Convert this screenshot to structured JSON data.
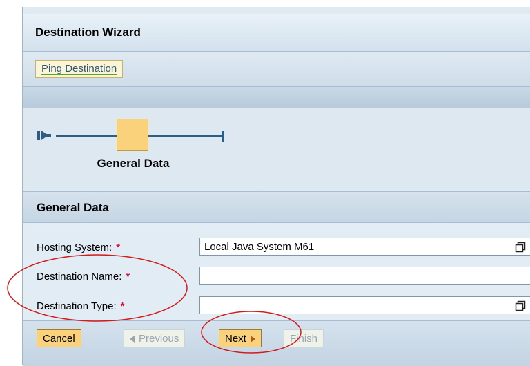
{
  "wizard": {
    "title": "Destination Wizard",
    "toolbar": {
      "ping_label": "Ping Destination"
    },
    "roadmap": {
      "step_label": "General Data"
    },
    "section_title": "General Data",
    "form": {
      "hosting_system": {
        "label": "Hosting System:",
        "value": "Local Java System M61",
        "required_mark": "*"
      },
      "destination_name": {
        "label": "Destination Name:",
        "value": "",
        "required_mark": "*"
      },
      "destination_type": {
        "label": "Destination Type:",
        "value": "",
        "required_mark": "*"
      }
    },
    "footer": {
      "cancel_label": "Cancel",
      "previous_label": "Previous",
      "next_label": "Next",
      "finish_label": "Finish"
    }
  },
  "colors": {
    "accent_button": "#fbd27c",
    "required_mark": "#d0173c",
    "annotation": "#d21a1a",
    "panel_bg": "#dfeaf3"
  },
  "icons": {
    "roadmap_start": "roadmap-start-icon",
    "roadmap_end": "roadmap-end-icon",
    "value_help": "value-help-icon"
  }
}
